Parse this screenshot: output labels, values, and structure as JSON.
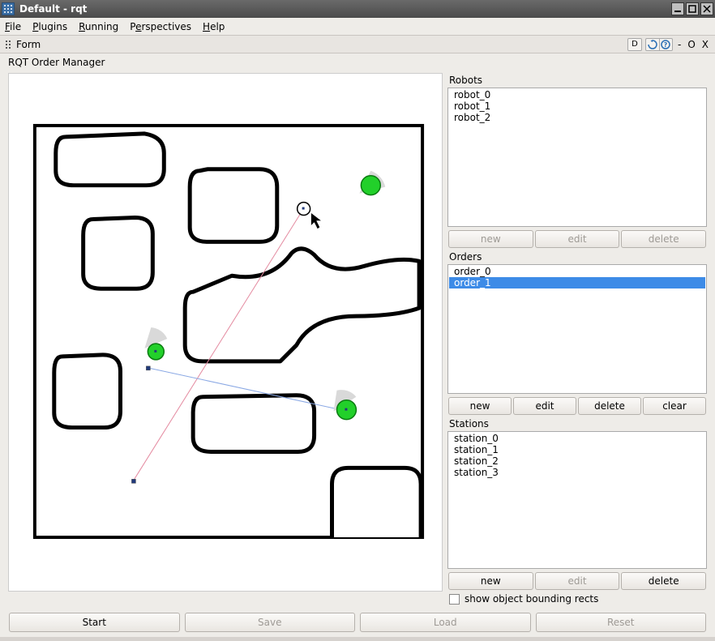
{
  "window": {
    "title": "Default - rqt"
  },
  "menubar": [
    {
      "label": "File",
      "accel": "F"
    },
    {
      "label": "Plugins",
      "accel": "P"
    },
    {
      "label": "Running",
      "accel": "R"
    },
    {
      "label": "Perspectives",
      "accel": "e",
      "raw": "Perspectives"
    },
    {
      "label": "Help",
      "accel": "H"
    }
  ],
  "toolbar": {
    "form_label": "Form",
    "d_label": "D"
  },
  "subtitle": "RQT Order Manager",
  "panels": {
    "robots": {
      "label": "Robots",
      "items": [
        "robot_0",
        "robot_1",
        "robot_2"
      ],
      "buttons": {
        "new": "new",
        "edit": "edit",
        "delete": "delete"
      }
    },
    "orders": {
      "label": "Orders",
      "items": [
        "order_0",
        "order_1"
      ],
      "selected": 1,
      "buttons": {
        "new": "new",
        "edit": "edit",
        "delete": "delete",
        "clear": "clear"
      }
    },
    "stations": {
      "label": "Stations",
      "items": [
        "station_0",
        "station_1",
        "station_2",
        "station_3"
      ],
      "buttons": {
        "new": "new",
        "edit": "edit",
        "delete": "delete"
      }
    }
  },
  "checkbox": {
    "label": "show object bounding rects",
    "checked": false
  },
  "bottom_buttons": {
    "start": "Start",
    "save": "Save",
    "load": "Load",
    "reset": "Reset"
  },
  "colors": {
    "robot_fill": "#22d02a",
    "selection": "#3d8be7"
  }
}
